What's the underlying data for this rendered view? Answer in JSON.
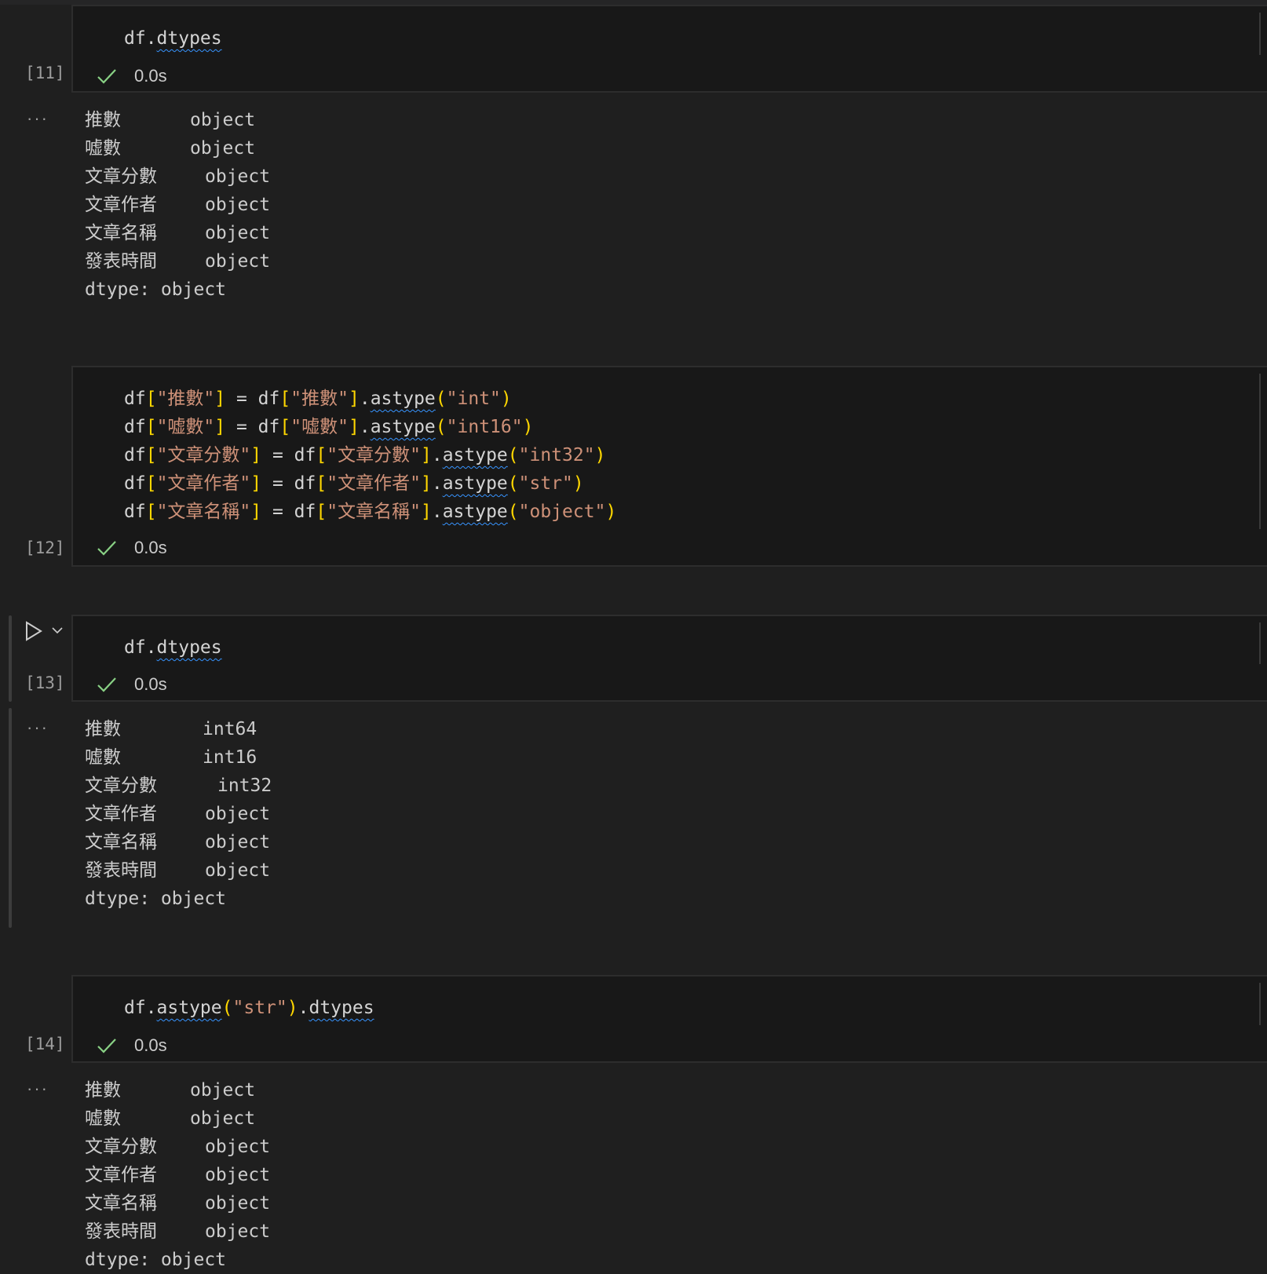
{
  "cells": [
    {
      "exec_count": "[11]",
      "status_time": "0.0s",
      "code": [
        "df.dtypes"
      ],
      "output": [
        {
          "key": "推數",
          "val": "object"
        },
        {
          "key": "嘘數",
          "val": "object"
        },
        {
          "key": "文章分數",
          "val": "object"
        },
        {
          "key": "文章作者",
          "val": "object"
        },
        {
          "key": "文章名稱",
          "val": "object"
        },
        {
          "key": "發表時間",
          "val": "object"
        }
      ],
      "dtype_line": "dtype: object"
    },
    {
      "exec_count": "[12]",
      "status_time": "0.0s",
      "code": [
        "df[\"推數\"] = df[\"推數\"].astype(\"int\")",
        "df[\"嘘數\"] = df[\"嘘數\"].astype(\"int16\")",
        "df[\"文章分數\"] = df[\"文章分數\"].astype(\"int32\")",
        "df[\"文章作者\"] = df[\"文章作者\"].astype(\"str\")",
        "df[\"文章名稱\"] = df[\"文章名稱\"].astype(\"object\")"
      ],
      "assignments": [
        {
          "col": "推數",
          "type": "int"
        },
        {
          "col": "嘘數",
          "type": "int16"
        },
        {
          "col": "文章分數",
          "type": "int32"
        },
        {
          "col": "文章作者",
          "type": "str"
        },
        {
          "col": "文章名稱",
          "type": "object"
        }
      ]
    },
    {
      "exec_count": "[13]",
      "status_time": "0.0s",
      "code": [
        "df.dtypes"
      ],
      "output": [
        {
          "key": "推數",
          "val": "int64"
        },
        {
          "key": "嘘數",
          "val": "int16"
        },
        {
          "key": "文章分數",
          "val": "int32"
        },
        {
          "key": "文章作者",
          "val": "object"
        },
        {
          "key": "文章名稱",
          "val": "object"
        },
        {
          "key": "發表時間",
          "val": "object"
        }
      ],
      "dtype_line": "dtype: object"
    },
    {
      "exec_count": "[14]",
      "status_time": "0.0s",
      "code": [
        "df.astype(\"str\").dtypes"
      ],
      "astype_arg": "str",
      "output": [
        {
          "key": "推數",
          "val": "object"
        },
        {
          "key": "嘘數",
          "val": "object"
        },
        {
          "key": "文章分數",
          "val": "object"
        },
        {
          "key": "文章作者",
          "val": "object"
        },
        {
          "key": "文章名稱",
          "val": "object"
        },
        {
          "key": "發表時間",
          "val": "object"
        }
      ],
      "dtype_line": "dtype: object"
    }
  ],
  "output_dots": "···",
  "icons": {
    "status": "check-icon",
    "run": "play-icon",
    "run_menu": "chevron-down-icon"
  },
  "colors": {
    "check": "#89d185",
    "string": "#ce9178",
    "bracket": "#ffd700",
    "squiggle": "#3794ff"
  }
}
